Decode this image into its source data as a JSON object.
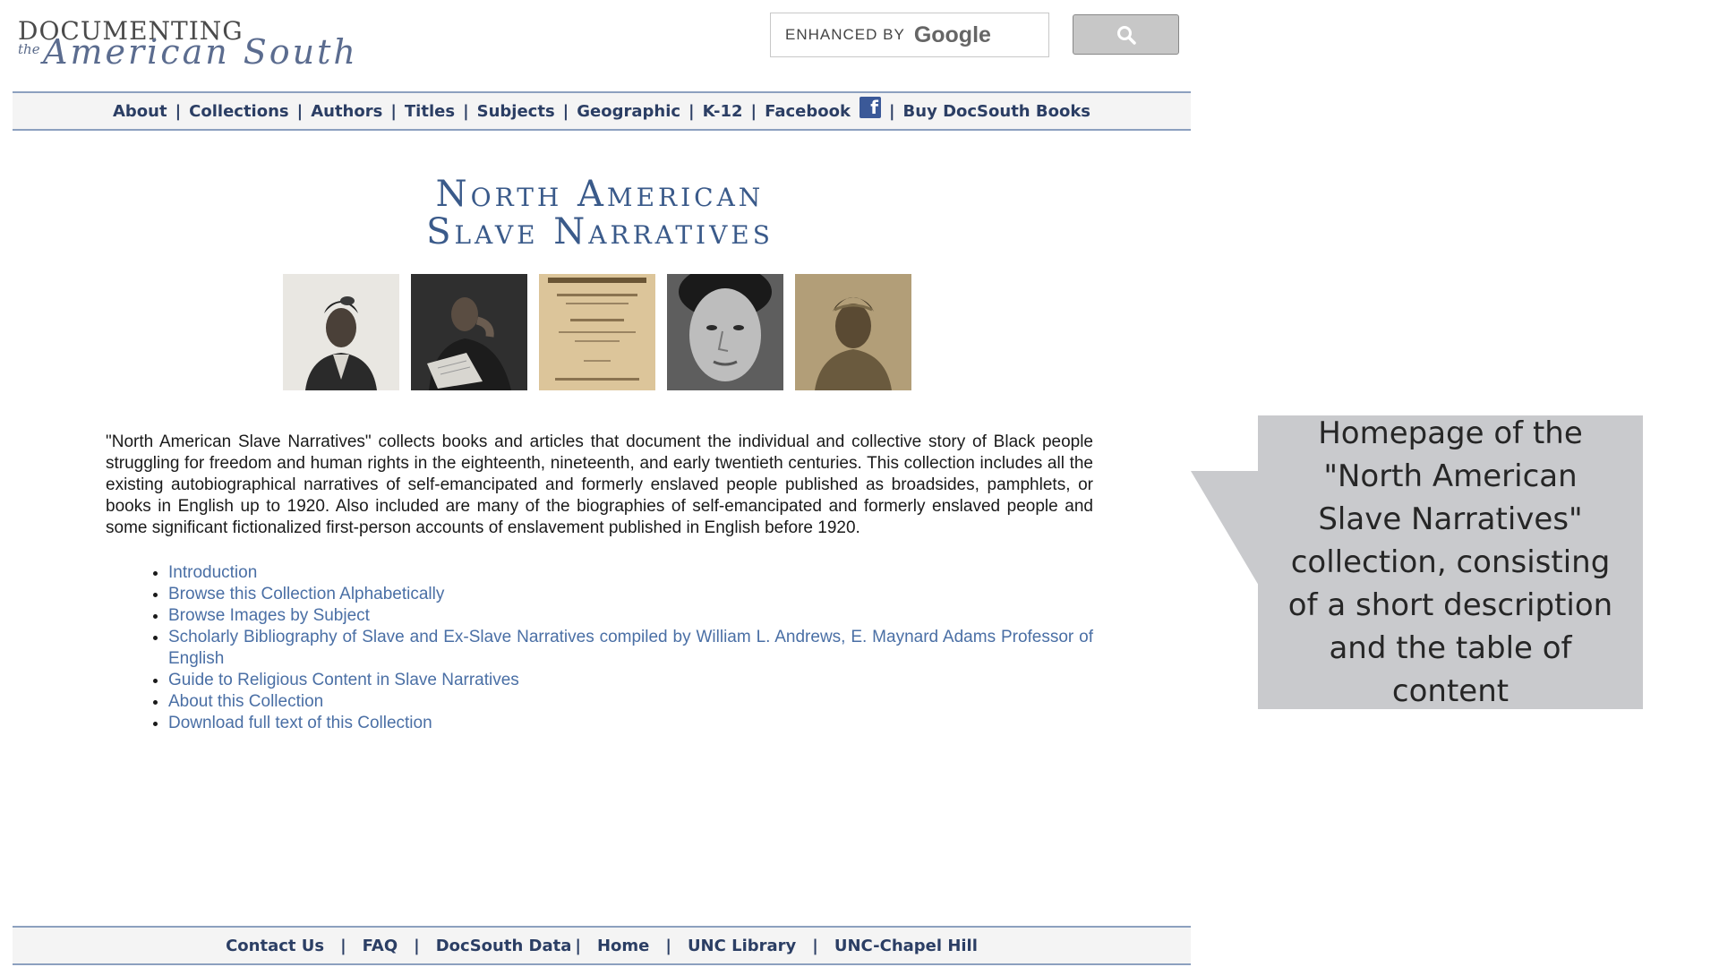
{
  "logo": {
    "line1": "DOCUMENTING",
    "the": "the",
    "line2": "American South"
  },
  "search": {
    "prefix": "ENHANCED BY",
    "brand": "Google",
    "button_icon": "search-icon"
  },
  "nav": {
    "items": [
      "About",
      "Collections",
      "Authors",
      "Titles",
      "Subjects",
      "Geographic",
      "K-12",
      "Facebook",
      "Buy DocSouth Books"
    ],
    "facebook_icon": "f"
  },
  "title": {
    "line1": "North American",
    "line2": "Slave Narratives"
  },
  "description": "\"North American Slave Narratives\" collects books and articles that document the individual and collective story of Black people struggling for freedom and human rights in the eighteenth, nineteenth, and early twentieth centuries. This collection includes all the existing autobiographical narratives of self-emancipated and formerly enslaved people published as broadsides, pamphlets, or books in English up to 1920. Also included are many of the biographies of self-emancipated and formerly enslaved people and some significant fictionalized first-person accounts of enslavement published in English before 1920.",
  "toc": [
    "Introduction",
    "Browse this Collection Alphabetically",
    "Browse Images by Subject",
    "Scholarly Bibliography of Slave and Ex-Slave Narratives compiled by William L. Andrews, E. Maynard Adams Professor of English",
    "Guide to Religious Content in Slave Narratives",
    "About this Collection",
    "Download full text of this Collection"
  ],
  "footer": {
    "items": [
      "Contact Us",
      "FAQ",
      "DocSouth Data",
      "Home",
      "UNC Library",
      "UNC-Chapel Hill"
    ]
  },
  "callout": "Homepage of the \"North American Slave Narratives\" collection, consisting of a short description and the table of content",
  "colors": {
    "nav_text": "#2b3e64",
    "link": "#4a6fa5",
    "title": "#3a5a8a",
    "callout_bg": "#c9cacd"
  }
}
